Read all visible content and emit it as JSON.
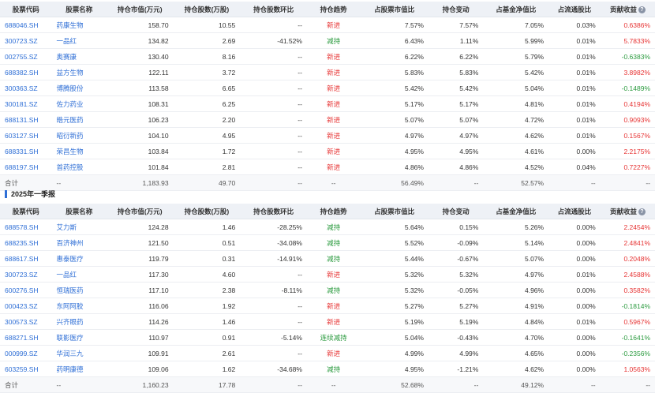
{
  "headers": {
    "code": "股票代码",
    "name": "股票名称",
    "market_value": "持仓市值(万元)",
    "shares": "持仓股数(万股)",
    "shares_change": "持仓股数环比",
    "trend": "持仓趋势",
    "pct_stock_mv": "占股票市值比",
    "pct_change": "持仓变动",
    "pct_nav": "占基金净值比",
    "pct_float": "占流通股比",
    "contribution": "贡献收益",
    "info_icon": "?"
  },
  "section2_title": "2025年一季报",
  "table1": {
    "rows": [
      {
        "code": "688046.SH",
        "name": "药康生物",
        "mv": "158.70",
        "shares": "10.55",
        "chg": "--",
        "trend": "新进",
        "trend_type": "new",
        "pct": "7.57%",
        "cc": "7.57%",
        "nav": "7.05%",
        "fl": "0.03%",
        "ct": "0.6386%",
        "ct_type": "red"
      },
      {
        "code": "300723.SZ",
        "name": "一品红",
        "mv": "134.82",
        "shares": "2.69",
        "chg": "-41.52%",
        "trend": "减持",
        "trend_type": "green",
        "pct": "6.43%",
        "cc": "1.11%",
        "nav": "5.99%",
        "fl": "0.01%",
        "ct": "5.7833%",
        "ct_type": "red"
      },
      {
        "code": "002755.SZ",
        "name": "奥赛康",
        "mv": "130.40",
        "shares": "8.16",
        "chg": "--",
        "trend": "新进",
        "trend_type": "new",
        "pct": "6.22%",
        "cc": "6.22%",
        "nav": "5.79%",
        "fl": "0.01%",
        "ct": "-0.6383%",
        "ct_type": "green"
      },
      {
        "code": "688382.SH",
        "name": "益方生物",
        "mv": "122.11",
        "shares": "3.72",
        "chg": "--",
        "trend": "新进",
        "trend_type": "new",
        "pct": "5.83%",
        "cc": "5.83%",
        "nav": "5.42%",
        "fl": "0.01%",
        "ct": "3.8982%",
        "ct_type": "red"
      },
      {
        "code": "300363.SZ",
        "name": "博腾股份",
        "mv": "113.58",
        "shares": "6.65",
        "chg": "--",
        "trend": "新进",
        "trend_type": "new",
        "pct": "5.42%",
        "cc": "5.42%",
        "nav": "5.04%",
        "fl": "0.01%",
        "ct": "-0.1489%",
        "ct_type": "green"
      },
      {
        "code": "300181.SZ",
        "name": "佐力药业",
        "mv": "108.31",
        "shares": "6.25",
        "chg": "--",
        "trend": "新进",
        "trend_type": "new",
        "pct": "5.17%",
        "cc": "5.17%",
        "nav": "4.81%",
        "fl": "0.01%",
        "ct": "0.4194%",
        "ct_type": "red"
      },
      {
        "code": "688131.SH",
        "name": "皓元医药",
        "mv": "106.23",
        "shares": "2.20",
        "chg": "--",
        "trend": "新进",
        "trend_type": "new",
        "pct": "5.07%",
        "cc": "5.07%",
        "nav": "4.72%",
        "fl": "0.01%",
        "ct": "0.9093%",
        "ct_type": "red"
      },
      {
        "code": "603127.SH",
        "name": "昭衍新药",
        "mv": "104.10",
        "shares": "4.95",
        "chg": "--",
        "trend": "新进",
        "trend_type": "new",
        "pct": "4.97%",
        "cc": "4.97%",
        "nav": "4.62%",
        "fl": "0.01%",
        "ct": "0.1567%",
        "ct_type": "red"
      },
      {
        "code": "688331.SH",
        "name": "荣昌生物",
        "mv": "103.84",
        "shares": "1.72",
        "chg": "--",
        "trend": "新进",
        "trend_type": "new",
        "pct": "4.95%",
        "cc": "4.95%",
        "nav": "4.61%",
        "fl": "0.00%",
        "ct": "2.2175%",
        "ct_type": "red"
      },
      {
        "code": "688197.SH",
        "name": "首药控股",
        "mv": "101.84",
        "shares": "2.81",
        "chg": "--",
        "trend": "新进",
        "trend_type": "new",
        "pct": "4.86%",
        "cc": "4.86%",
        "nav": "4.52%",
        "fl": "0.04%",
        "ct": "0.7227%",
        "ct_type": "red"
      }
    ],
    "total": {
      "label": "合计",
      "code": "--",
      "mv": "1,183.93",
      "shares": "49.70",
      "chg": "--",
      "trend": "--",
      "pct": "56.49%",
      "cc": "--",
      "nav": "52.57%",
      "fl": "--",
      "ct": "--"
    }
  },
  "table2": {
    "rows": [
      {
        "code": "688578.SH",
        "name": "艾力斯",
        "mv": "124.28",
        "shares": "1.46",
        "chg": "-28.25%",
        "trend": "减持",
        "trend_type": "green",
        "pct": "5.64%",
        "cc": "0.15%",
        "nav": "5.26%",
        "fl": "0.00%",
        "ct": "2.2454%",
        "ct_type": "red"
      },
      {
        "code": "688235.SH",
        "name": "百济神州",
        "mv": "121.50",
        "shares": "0.51",
        "chg": "-34.08%",
        "trend": "减持",
        "trend_type": "green",
        "pct": "5.52%",
        "cc": "-0.09%",
        "nav": "5.14%",
        "fl": "0.00%",
        "ct": "2.4841%",
        "ct_type": "red"
      },
      {
        "code": "688617.SH",
        "name": "惠泰医疗",
        "mv": "119.79",
        "shares": "0.31",
        "chg": "-14.91%",
        "trend": "减持",
        "trend_type": "green",
        "pct": "5.44%",
        "cc": "-0.67%",
        "nav": "5.07%",
        "fl": "0.00%",
        "ct": "0.2048%",
        "ct_type": "red"
      },
      {
        "code": "300723.SZ",
        "name": "一品红",
        "mv": "117.30",
        "shares": "4.60",
        "chg": "--",
        "trend": "新进",
        "trend_type": "new",
        "pct": "5.32%",
        "cc": "5.32%",
        "nav": "4.97%",
        "fl": "0.01%",
        "ct": "2.4588%",
        "ct_type": "red"
      },
      {
        "code": "600276.SH",
        "name": "恒瑞医药",
        "mv": "117.10",
        "shares": "2.38",
        "chg": "-8.11%",
        "trend": "减持",
        "trend_type": "green",
        "pct": "5.32%",
        "cc": "-0.05%",
        "nav": "4.96%",
        "fl": "0.00%",
        "ct": "0.3582%",
        "ct_type": "red"
      },
      {
        "code": "000423.SZ",
        "name": "东阿阿胶",
        "mv": "116.06",
        "shares": "1.92",
        "chg": "--",
        "trend": "新进",
        "trend_type": "new",
        "pct": "5.27%",
        "cc": "5.27%",
        "nav": "4.91%",
        "fl": "0.00%",
        "ct": "-0.1814%",
        "ct_type": "green"
      },
      {
        "code": "300573.SZ",
        "name": "兴齐眼药",
        "mv": "114.26",
        "shares": "1.46",
        "chg": "--",
        "trend": "新进",
        "trend_type": "new",
        "pct": "5.19%",
        "cc": "5.19%",
        "nav": "4.84%",
        "fl": "0.01%",
        "ct": "0.5967%",
        "ct_type": "red"
      },
      {
        "code": "688271.SH",
        "name": "联影医疗",
        "mv": "110.97",
        "shares": "0.91",
        "chg": "-5.14%",
        "trend": "连续减持",
        "trend_type": "green",
        "pct": "5.04%",
        "cc": "-0.43%",
        "nav": "4.70%",
        "fl": "0.00%",
        "ct": "-0.1641%",
        "ct_type": "green"
      },
      {
        "code": "000999.SZ",
        "name": "华润三九",
        "mv": "109.91",
        "shares": "2.61",
        "chg": "--",
        "trend": "新进",
        "trend_type": "new",
        "pct": "4.99%",
        "cc": "4.99%",
        "nav": "4.65%",
        "fl": "0.00%",
        "ct": "-0.2356%",
        "ct_type": "green"
      },
      {
        "code": "603259.SH",
        "name": "药明康德",
        "mv": "109.06",
        "shares": "1.62",
        "chg": "-34.68%",
        "trend": "减持",
        "trend_type": "green",
        "pct": "4.95%",
        "cc": "-1.21%",
        "nav": "4.62%",
        "fl": "0.00%",
        "ct": "1.0563%",
        "ct_type": "red"
      }
    ],
    "total": {
      "label": "合计",
      "code": "--",
      "mv": "1,160.23",
      "shares": "17.78",
      "chg": "--",
      "trend": "--",
      "pct": "52.68%",
      "cc": "--",
      "nav": "49.12%",
      "fl": "--",
      "ct": "--"
    }
  }
}
